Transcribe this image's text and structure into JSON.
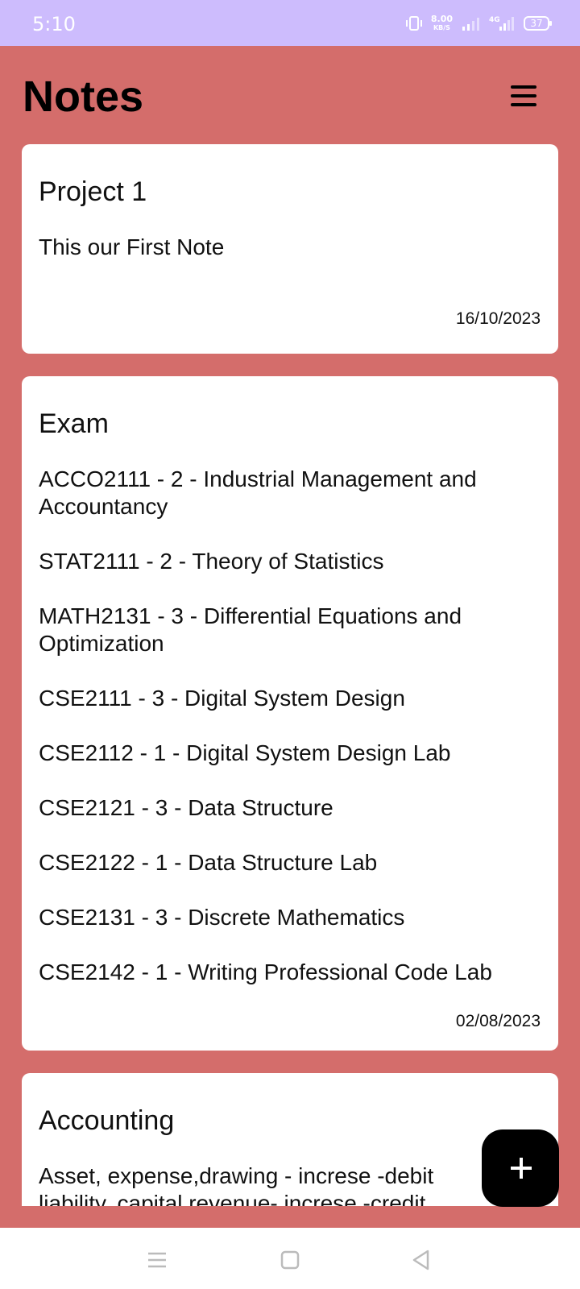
{
  "status_bar": {
    "time": "5:10",
    "net_speed_value": "8.00",
    "net_speed_unit": "KB/S",
    "network_label": "4G",
    "battery": "37",
    "icons": [
      "vibrate-icon",
      "signal-icon",
      "signal-4g-icon",
      "battery-icon"
    ]
  },
  "header": {
    "title": "Notes",
    "menu_icon": "hamburger-menu-icon"
  },
  "notes": [
    {
      "title": "Project 1",
      "lines": [
        "This our First Note"
      ],
      "date": "16/10/2023"
    },
    {
      "title": "Exam",
      "lines": [
        "ACCO2111 - 2 - Industrial Management and Accountancy",
        "STAT2111 - 2 - Theory of Statistics",
        "MATH2131 - 3 - Differential Equations and Optimization",
        "CSE2111 - 3 - Digital System Design",
        "CSE2112 - 1 - Digital System Design Lab",
        "CSE2121 - 3 - Data Structure",
        "CSE2122 - 1 - Data Structure Lab",
        "CSE2131 - 3 - Discrete Mathematics",
        "CSE2142 - 1 - Writing Professional Code Lab"
      ],
      "date": "02/08/2023"
    },
    {
      "title": "Accounting",
      "lines": [
        "Asset, expense,drawing - increse -debit",
        "liability, capital,revenue- increse -credit"
      ],
      "date": ""
    }
  ],
  "fab": {
    "icon": "plus-icon"
  },
  "nav_bar": {
    "icons": [
      "recents-icon",
      "home-icon",
      "back-icon"
    ]
  },
  "colors": {
    "status_bar": "#cdbcfd",
    "background": "#d46d6b",
    "card": "#ffffff",
    "fab": "#000000"
  }
}
